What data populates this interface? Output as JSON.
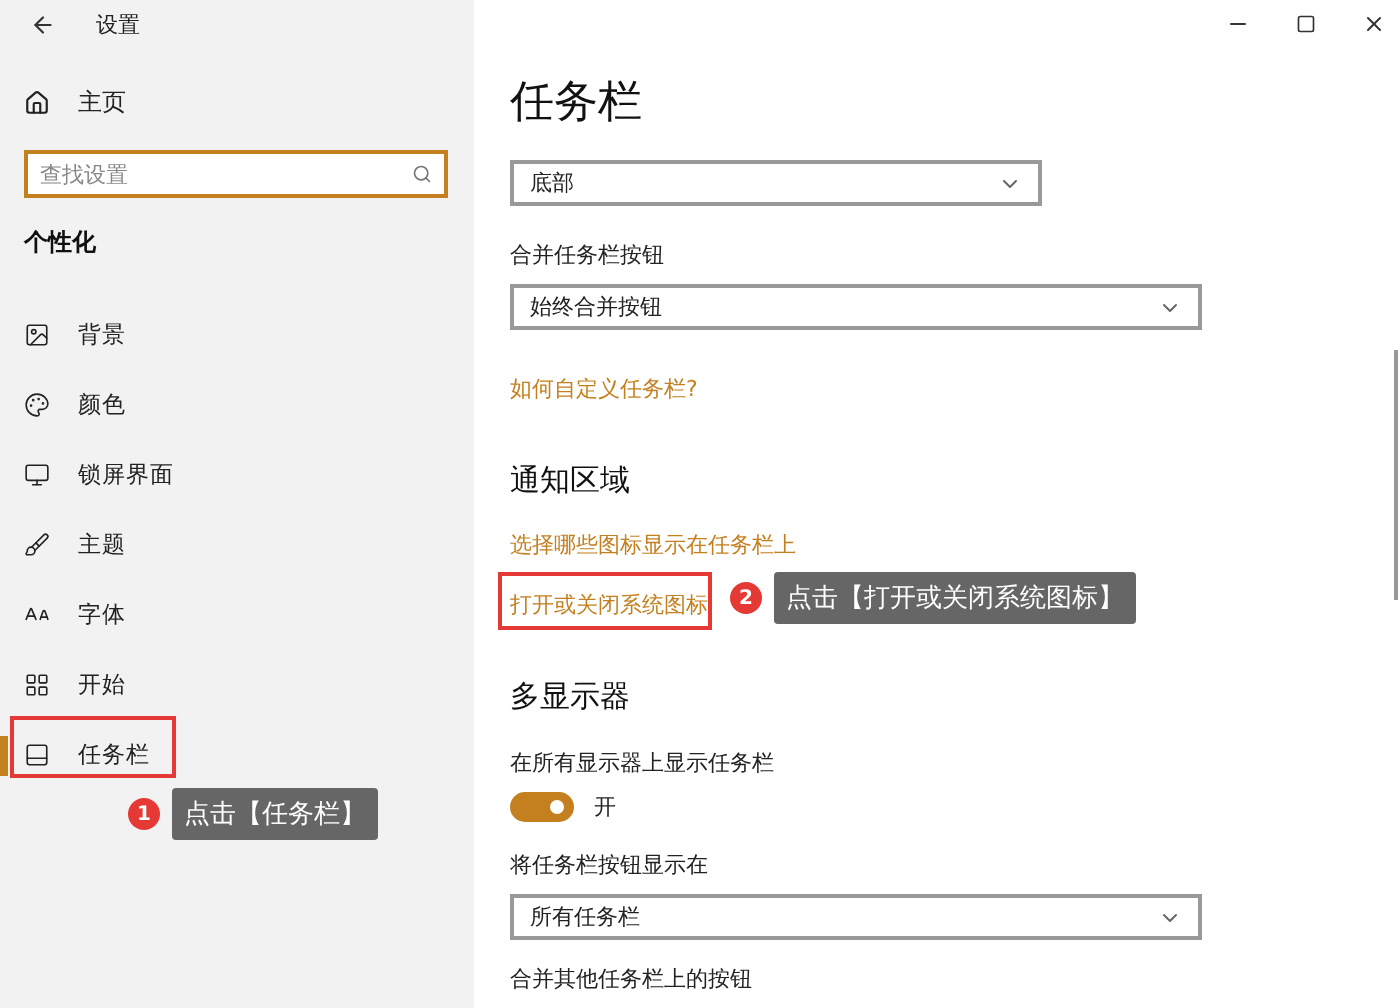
{
  "window": {
    "title": "设置"
  },
  "sidebar": {
    "home": "主页",
    "search": {
      "placeholder": "查找设置"
    },
    "section": "个性化",
    "items": [
      {
        "label": "背景",
        "selected": false
      },
      {
        "label": "颜色",
        "selected": false
      },
      {
        "label": "锁屏界面",
        "selected": false
      },
      {
        "label": "主题",
        "selected": false
      },
      {
        "label": "字体",
        "selected": false
      },
      {
        "label": "开始",
        "selected": false
      },
      {
        "label": "任务栏",
        "selected": true,
        "annotation": {
          "number": "1",
          "text": "点击【任务栏】"
        }
      }
    ]
  },
  "main": {
    "title": "任务栏",
    "blocks": [
      {
        "kind": "dropdown",
        "value": "底部"
      },
      {
        "kind": "dropdown",
        "label": "合并任务栏按钮",
        "value": "始终合并按钮",
        "wide": true
      },
      {
        "kind": "link",
        "text": "如何自定义任务栏?"
      },
      {
        "kind": "heading",
        "text": "通知区域"
      },
      {
        "kind": "link",
        "text": "选择哪些图标显示在任务栏上"
      },
      {
        "kind": "link",
        "text": "打开或关闭系统图标",
        "annotation": {
          "number": "2",
          "text": "点击【打开或关闭系统图标】"
        }
      },
      {
        "kind": "heading",
        "text": "多显示器"
      },
      {
        "kind": "toggle",
        "label": "在所有显示器上显示任务栏",
        "on": true,
        "state": "开"
      },
      {
        "kind": "dropdown",
        "label": "将任务栏按钮显示在",
        "value": "所有任务栏",
        "wide": true
      },
      {
        "kind": "label",
        "text": "合并其他任务栏上的按钮"
      }
    ]
  }
}
